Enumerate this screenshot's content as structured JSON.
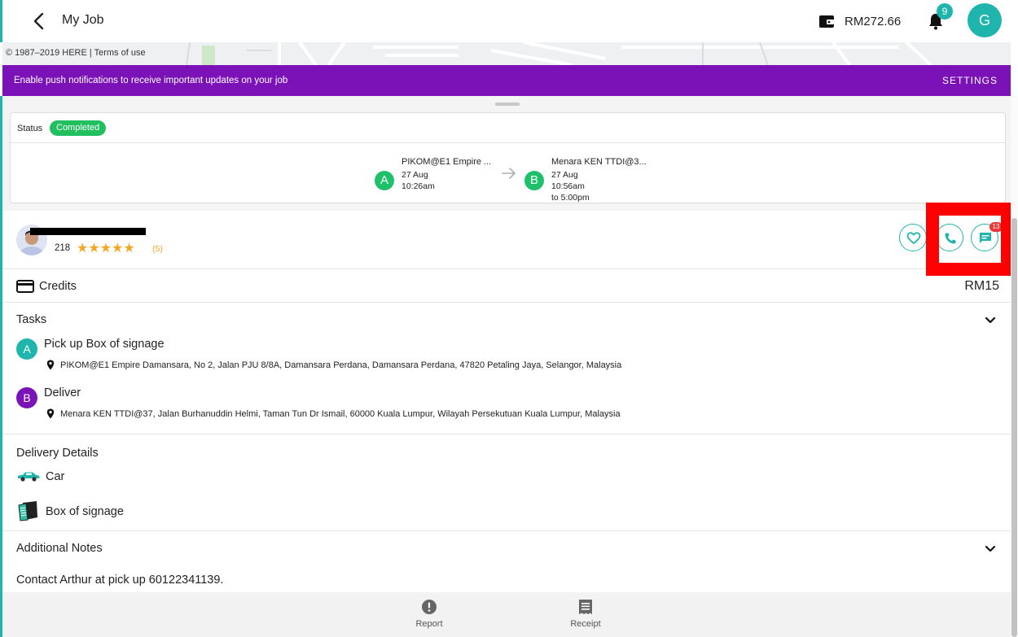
{
  "header": {
    "title": "My Job",
    "balance": "RM272.66",
    "notification_count": "9",
    "avatar_initial": "G"
  },
  "map": {
    "copyright": "© 1987–2019 HERE | Terms of use"
  },
  "banner": {
    "text": "Enable push notifications to receive important updates on your job",
    "settings_label": "SETTINGS"
  },
  "status": {
    "label": "Status",
    "value": "Completed"
  },
  "route": {
    "pickup": {
      "letter": "A",
      "name": "PIKOM@E1 Empire ...",
      "date": "27 Aug",
      "time": "10:26am"
    },
    "dropoff": {
      "letter": "B",
      "name": "Menara KEN TTDI@3...",
      "date": "27 Aug",
      "time": "10:56am",
      "time_end": "to 5:00pm"
    }
  },
  "driver": {
    "count": "218",
    "stars": "★★★★★",
    "rating_count": "(5)",
    "chat_unread": "13"
  },
  "credits": {
    "label": "Credits",
    "value": "RM15"
  },
  "tasks": {
    "title": "Tasks",
    "items": [
      {
        "letter": "A",
        "title": "Pick up Box of signage",
        "address": "PIKOM@E1 Empire Damansara, No 2, Jalan PJU 8/8A, Damansara Perdana, Damansara Perdana, 47820 Petaling Jaya, Selangor, Malaysia"
      },
      {
        "letter": "B",
        "title": "Deliver",
        "address": "Menara KEN TTDI@37, Jalan Burhanuddin Helmi, Taman Tun Dr Ismail, 60000 Kuala Lumpur, Wilayah Persekutuan Kuala Lumpur, Malaysia"
      }
    ]
  },
  "delivery_details": {
    "title": "Delivery Details",
    "vehicle": "Car",
    "item": "Box of signage"
  },
  "notes": {
    "title": "Additional Notes",
    "text": "Contact Arthur at pick up 60122341139."
  },
  "bottom_bar": {
    "report_label": "Report",
    "receipt_label": "Receipt"
  },
  "colors": {
    "accent": "#1fb5ad",
    "banner": "#7b12b8",
    "status_green": "#22bf5f",
    "route_green": "#1ec06a",
    "task_a": "#1fb5ad",
    "task_b": "#7b12b8",
    "star": "#f5a623",
    "highlight": "#ff0000"
  },
  "icons": {
    "back": "chevron-left-icon",
    "wallet": "wallet-icon",
    "notifications": "bell-icon",
    "favorite": "heart-icon",
    "call": "phone-icon",
    "chat": "chat-icon",
    "credits": "credit-card-icon",
    "expand": "chevron-down-icon",
    "location": "map-pin-icon",
    "vehicle": "car-icon",
    "item": "box-icon",
    "report": "alert-icon",
    "receipt": "receipt-icon"
  }
}
